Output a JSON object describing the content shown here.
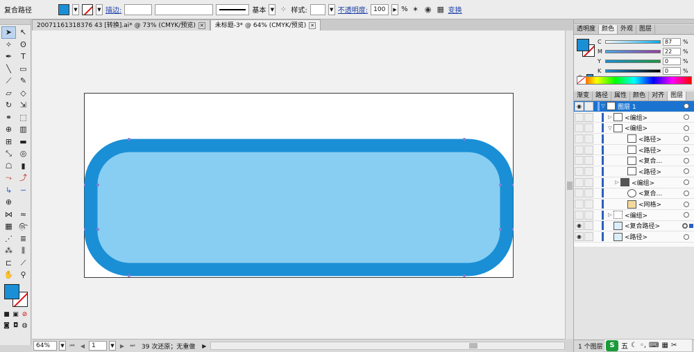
{
  "control_bar": {
    "object_type": "复合路径",
    "fill_color": "#1a8fd6",
    "stroke_label": "描边:",
    "stroke_weight": "",
    "stroke_profile": "基本",
    "style_label": "样式:",
    "opacity_label": "不透明度:",
    "opacity_value": "100",
    "opacity_unit": "%",
    "transform_label": "变换"
  },
  "doc_tabs": [
    {
      "label": "20071161318376 43 [转换].ai* @ 73% (CMYK/预览)",
      "active": false
    },
    {
      "label": "未标题-3* @ 64% (CMYK/预览)",
      "active": true
    }
  ],
  "status_bar": {
    "zoom": "64%",
    "artboard_num": "1",
    "message": "39 次还原；无重做"
  },
  "color_panel": {
    "tabs": [
      "透明度",
      "颜色",
      "外观",
      "图层"
    ],
    "active_tab": "颜色",
    "fill_color": "#1a8fd6",
    "channels": [
      {
        "name": "C",
        "value": "87"
      },
      {
        "name": "M",
        "value": "22"
      },
      {
        "name": "Y",
        "value": "0"
      },
      {
        "name": "K",
        "value": "0"
      }
    ]
  },
  "layers_panel": {
    "tabs": [
      "渐变",
      "路径",
      "属性",
      "颜色",
      "对齐",
      "图层"
    ],
    "active_tab": "图层",
    "rows": [
      {
        "name": "图层 1",
        "indent": 0,
        "expanded": true,
        "selected": true,
        "visible": true
      },
      {
        "name": "<编组>",
        "indent": 1,
        "expanded": false,
        "selected": false,
        "visible": false
      },
      {
        "name": "<编组>",
        "indent": 1,
        "expanded": true,
        "selected": false,
        "visible": false
      },
      {
        "name": "<路径>",
        "indent": 2,
        "expanded": null,
        "selected": false,
        "visible": false
      },
      {
        "name": "<路径>",
        "indent": 2,
        "expanded": null,
        "selected": false,
        "visible": false
      },
      {
        "name": "<复合...",
        "indent": 2,
        "expanded": null,
        "selected": false,
        "visible": false
      },
      {
        "name": "<路径>",
        "indent": 2,
        "expanded": null,
        "selected": false,
        "visible": false
      },
      {
        "name": "<编组>",
        "indent": 2,
        "expanded": false,
        "selected": false,
        "visible": false
      },
      {
        "name": "<复合...",
        "indent": 2,
        "expanded": null,
        "selected": false,
        "visible": false
      },
      {
        "name": "<网格>",
        "indent": 2,
        "expanded": null,
        "selected": false,
        "visible": false
      },
      {
        "name": "<编组>",
        "indent": 1,
        "expanded": false,
        "selected": false,
        "visible": false
      },
      {
        "name": "<复合路径>",
        "indent": 1,
        "expanded": null,
        "selected": false,
        "visible": true,
        "target_selected": true
      },
      {
        "name": "<路径>",
        "indent": 1,
        "expanded": null,
        "selected": false,
        "visible": true
      }
    ],
    "count_text": "1 个图层"
  },
  "artwork": {
    "stroke_color": "#1a8fd6",
    "inner_fill": "#87cef2"
  },
  "ime": {
    "label": "五"
  }
}
